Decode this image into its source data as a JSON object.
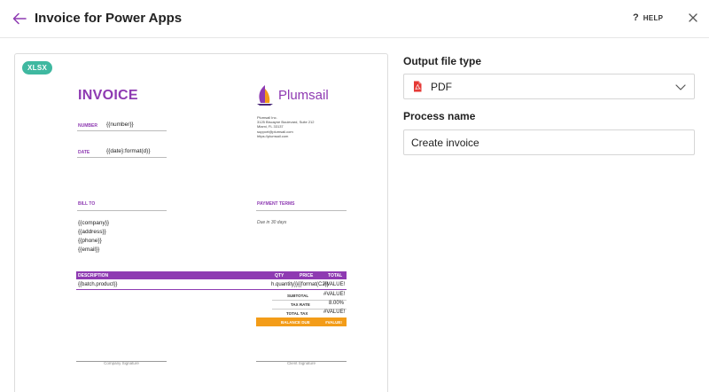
{
  "header": {
    "title": "Invoice for Power Apps",
    "help_label": "HELP",
    "help_glyph": "?",
    "back_icon": "arrow-left-icon",
    "close_icon": "close-icon"
  },
  "preview": {
    "badge": "XLSX",
    "template": {
      "title": "INVOICE",
      "logo_text": "Plumsail",
      "address_lines": [
        "Plumsail Inc.",
        "3125 Biscayne Boulevard, Suite 212",
        "Miami, FL 33137",
        "support@plumsail.com",
        "https://plumsail.com"
      ],
      "number_label": "NUMBER",
      "number_value": "{{number}}",
      "date_label": "DATE",
      "date_value": "{{date}:format(d)}",
      "bill_to_label": "BILL TO",
      "bill_to_lines": [
        "{{company}}",
        "{{address}}",
        "{{phone}}",
        "{{email}}"
      ],
      "payment_terms_label": "PAYMENT TERMS",
      "payment_terms_value": "Due in 30 days",
      "table_headers": {
        "description": "DESCRIPTION",
        "qty": "QTY",
        "price": "PRICE",
        "total": "TOTAL"
      },
      "row_description": "{{batch.product}}",
      "row_qty_price": "h.quantity}}{{format(C2)}",
      "row_total": "#VALUE!",
      "subtotal_label": "SUBTOTAL",
      "subtotal_value": "#VALUE!",
      "tax_rate_label": "TAX RATE",
      "tax_rate_value": "8.00%",
      "total_tax_label": "TOTAL TAX",
      "total_tax_value": "#VALUE!",
      "balance_due_label": "BALANCE DUE",
      "balance_due_value": "#VALUE!",
      "company_signature": "Company Signature",
      "client_signature": "Client Signature"
    }
  },
  "form": {
    "output_type_label": "Output file type",
    "output_type_value": "PDF",
    "process_name_label": "Process name",
    "process_name_value": "Create invoice"
  },
  "colors": {
    "accent": "#8e3ab2",
    "badge": "#3fb8a0",
    "balance": "#f39c18",
    "pdf_red": "#e53935"
  }
}
